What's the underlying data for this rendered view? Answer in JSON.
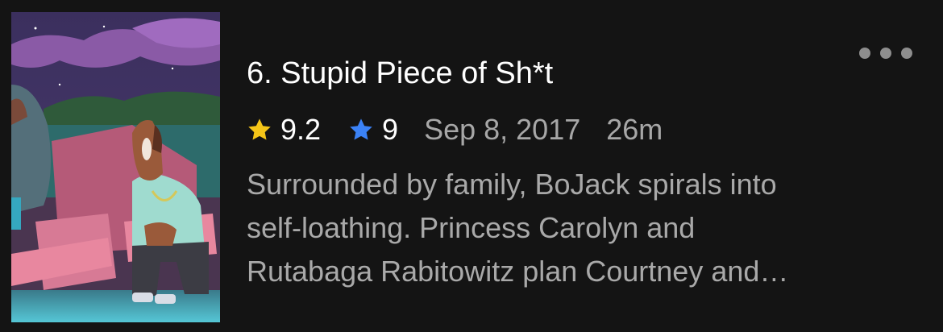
{
  "episode": {
    "title": "6. Stupid Piece of Sh*t",
    "rating_primary": "9.2",
    "rating_secondary": "9",
    "air_date": "Sep 8, 2017",
    "runtime": "26m",
    "description_lines": [
      "Surrounded by family, BoJack spirals into",
      "self-loathing. Princess Carolyn and",
      "Rutabaga Rabitowitz plan Courtney and…"
    ]
  },
  "icons": {
    "rating_primary_icon": "star-icon",
    "rating_primary_color": "#F5C518",
    "rating_secondary_icon": "star-icon",
    "rating_secondary_color": "#3B82F6",
    "more_icon": "more-horizontal-icon"
  }
}
